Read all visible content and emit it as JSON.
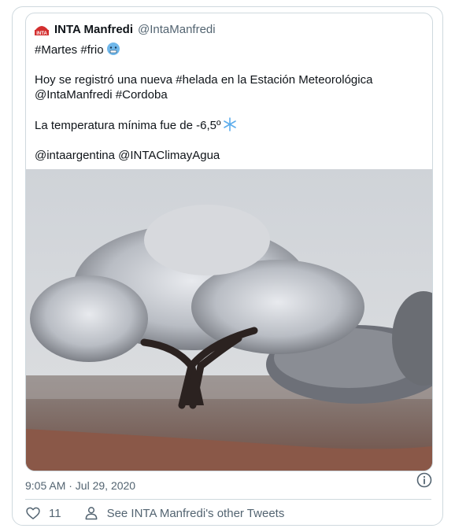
{
  "tweet": {
    "author_name": "INTA Manfredi",
    "author_handle": "@IntaManfredi",
    "logo_text": "INTA",
    "lines": [
      "#Martes #frio",
      "",
      "Hoy se registró una nueva #helada en la Estación Meteorológica",
      "@IntaManfredi #Cordoba",
      "",
      "La temperatura mínima fue de -6,5º",
      "",
      "@intaargentina @INTAClimayAgua"
    ],
    "emojis": [
      "cold-face-emoji",
      "snowflake-emoji"
    ],
    "image_description_icon": "frosted-tree-photo"
  },
  "meta": {
    "timestamp": "9:05 AM · Jul 29, 2020"
  },
  "actions": {
    "like_count": "11",
    "other_tweets_label": "See INTA Manfredi's other Tweets"
  },
  "icons": {
    "info": "info-icon",
    "like": "heart-icon",
    "profile": "person-icon"
  },
  "colors": {
    "border": "#cfd9de",
    "secondary_text": "#536471",
    "brand_red": "#d32f2f"
  }
}
